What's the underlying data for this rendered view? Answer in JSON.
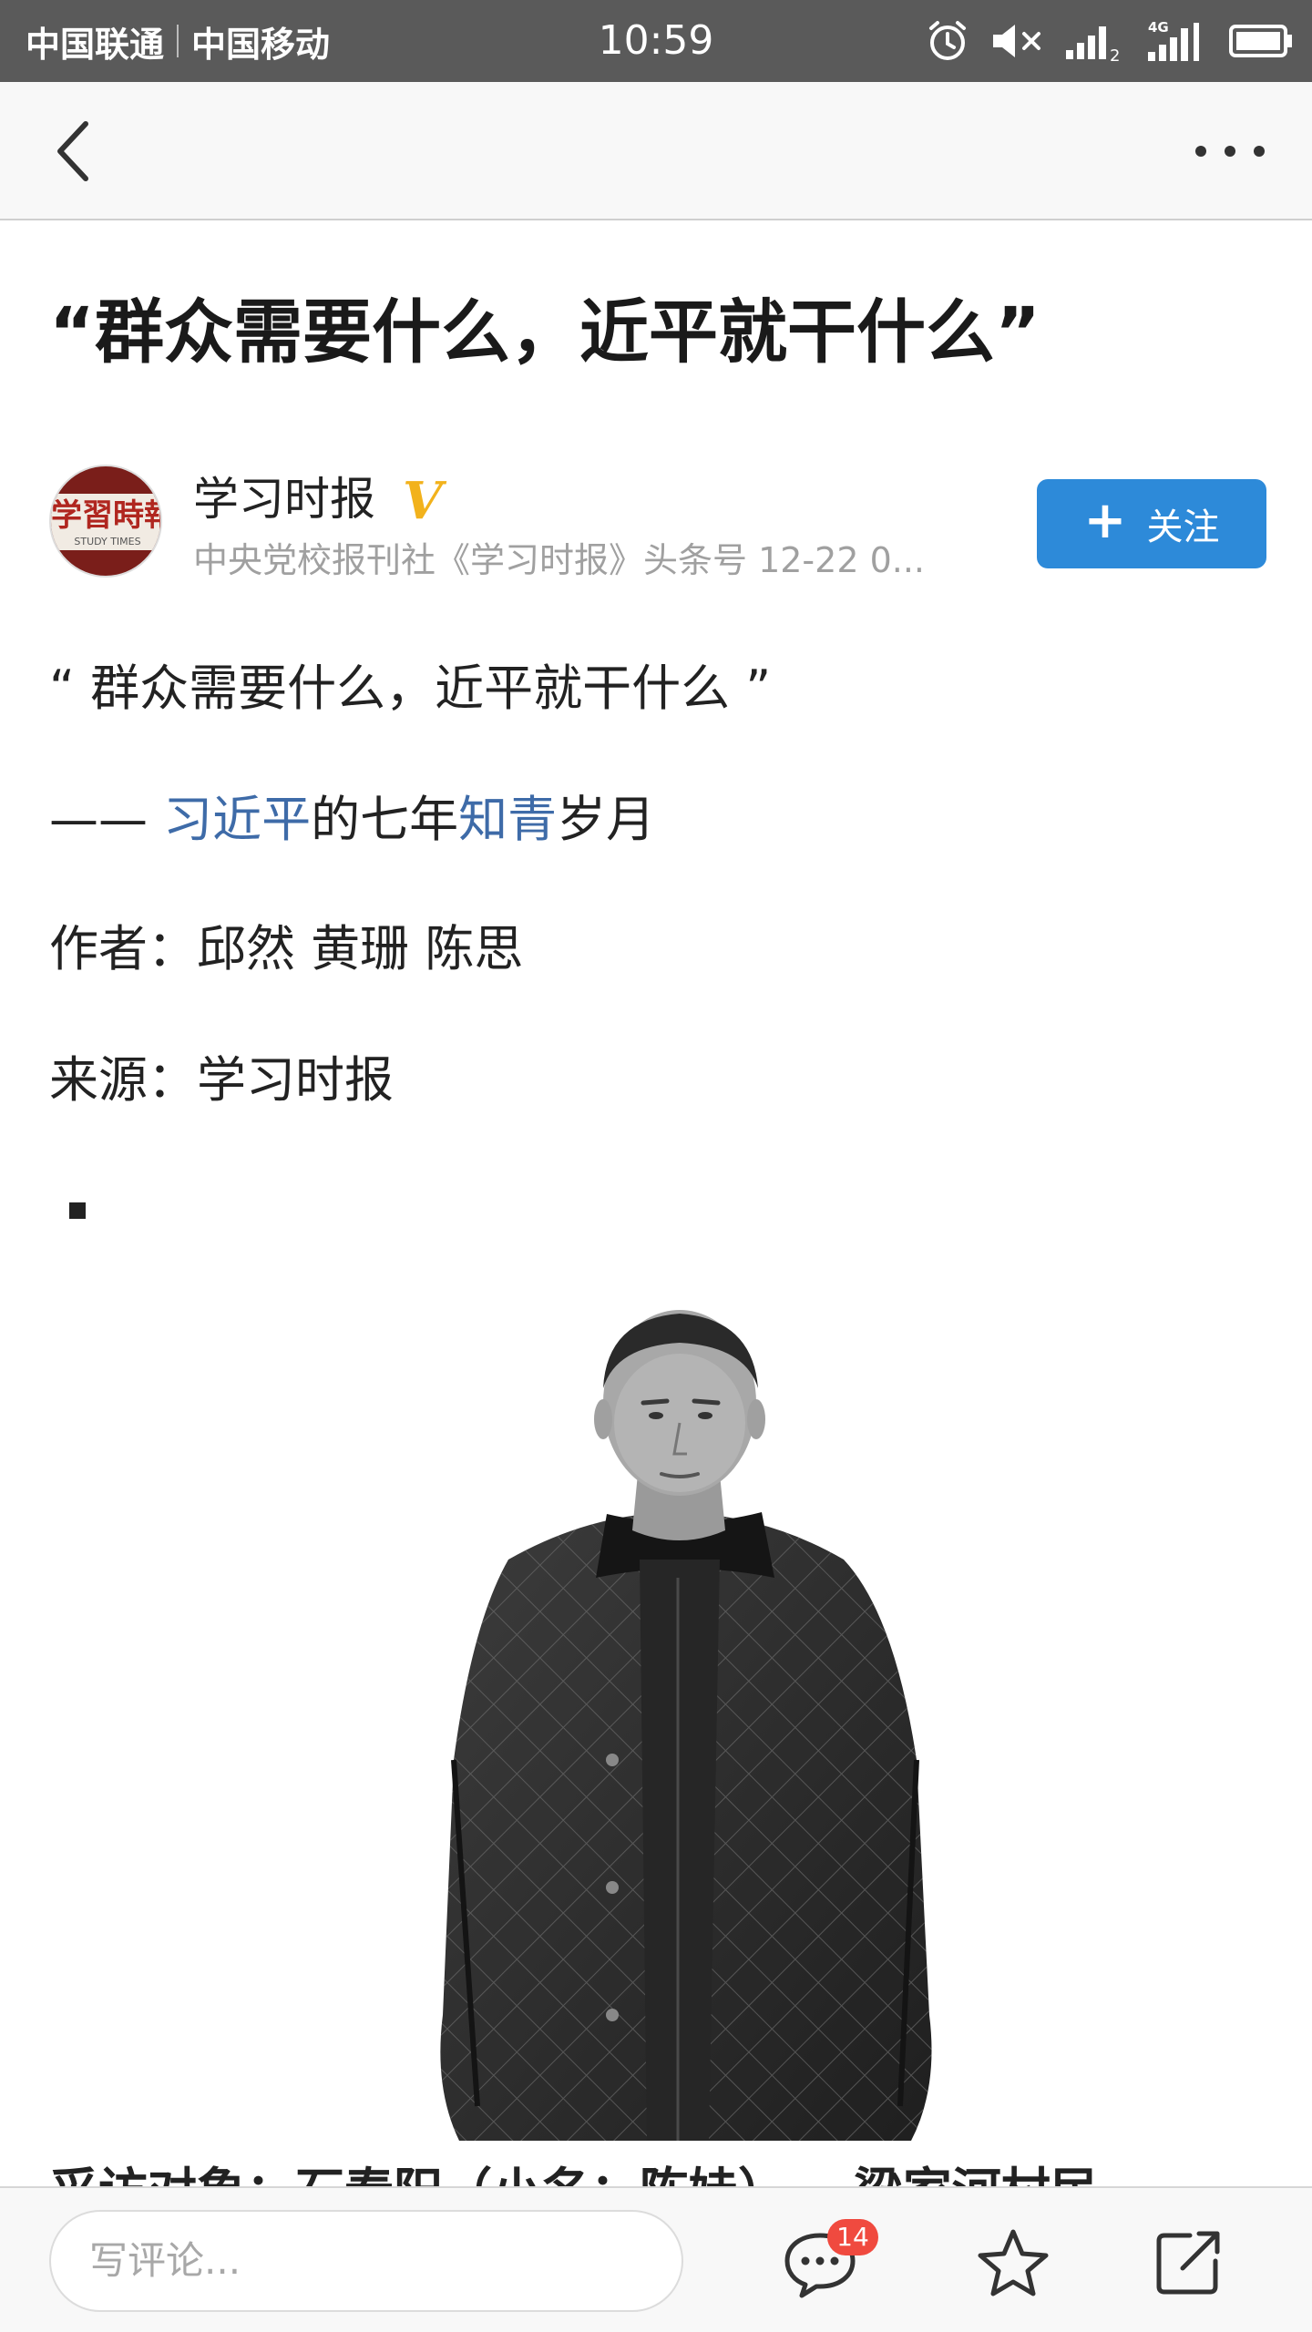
{
  "status_bar": {
    "carrier1": "中国联通",
    "carrier2": "中国移动",
    "time": "10:59",
    "icons": [
      "alarm-icon",
      "mute-icon",
      "signal-icon",
      "signal-4g-icon",
      "battery-icon"
    ]
  },
  "nav": {
    "back_icon": "chevron-left-icon",
    "more_icon": "more-horizontal-icon"
  },
  "article": {
    "title": "“群众需要什么，近平就干什么”",
    "author": {
      "name": "学习时报",
      "verified_badge": "V",
      "meta": "中央党校报刊社《学习时报》头条号 12-22 0...",
      "avatar_text": "学習時報",
      "avatar_subtext": "STUDY TIMES"
    },
    "follow_button": {
      "plus": "+",
      "label": "关注"
    },
    "quote_line": "“ 群众需要什么，近平就干什么 ”",
    "subtitle": {
      "prefix": "—— ",
      "link1": "习近平",
      "mid": "的七年",
      "link2": "知青",
      "suffix": "岁月"
    },
    "authors_line": "作者：邱然 黄珊 陈思",
    "source_line": "来源：学习时报",
    "photo_alt": "photo-of-interviewee",
    "cutline": "采访对象：石春阳（小名：陈娃）— 梁家河村民"
  },
  "bottom_bar": {
    "comment_placeholder": "写评论...",
    "comment_count": "14",
    "icons": [
      "comment-icon",
      "star-icon",
      "share-icon"
    ]
  },
  "colors": {
    "status_bar_bg": "#5a5a5a",
    "link": "#3e6ba8",
    "follow_button": "#2d8ad9",
    "verified": "#f2b21c",
    "badge": "#f04a3f"
  }
}
